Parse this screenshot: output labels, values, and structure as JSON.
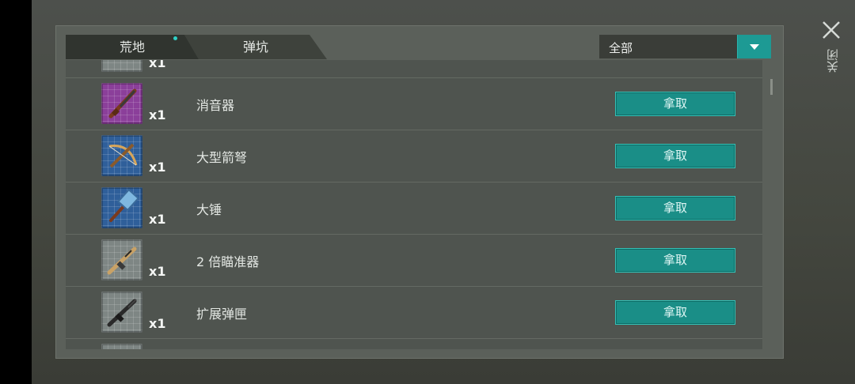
{
  "tabs": [
    {
      "label": "荒地",
      "active": true
    },
    {
      "label": "弹坑",
      "active": false
    }
  ],
  "filter": {
    "selected": "全部"
  },
  "close_label": "关闭",
  "items": [
    {
      "name": "",
      "qty": "x1",
      "icon": "crate-icon",
      "color": "gray",
      "button": ""
    },
    {
      "name": "消音器",
      "qty": "x1",
      "icon": "rifle-icon",
      "color": "purple",
      "button": "拿取"
    },
    {
      "name": "大型箭弩",
      "qty": "x1",
      "icon": "crossbow-icon",
      "color": "blue",
      "button": "拿取"
    },
    {
      "name": "大锤",
      "qty": "x1",
      "icon": "hammer-icon",
      "color": "blue",
      "button": "拿取"
    },
    {
      "name": "2 倍瞄准器",
      "qty": "x1",
      "icon": "assault-rifle-icon",
      "color": "gray",
      "button": "拿取"
    },
    {
      "name": "扩展弹匣",
      "qty": "x1",
      "icon": "rifle-black-icon",
      "color": "gray",
      "button": "拿取"
    }
  ],
  "colors": {
    "accent": "#1a8e87",
    "dot": "#2fd1c7"
  }
}
